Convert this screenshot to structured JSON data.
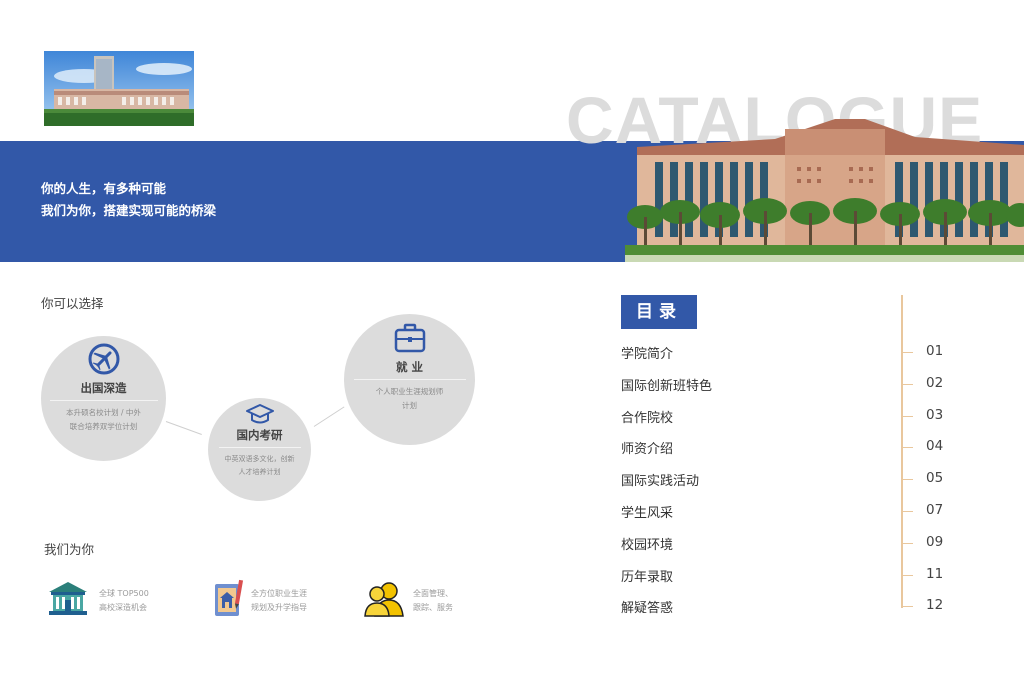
{
  "watermark": "CATALOGUE",
  "banner": {
    "line1": "你的人生，有多种可能",
    "line2": "我们为你，搭建实现可能的桥梁"
  },
  "choices": {
    "title": "你可以选择",
    "items": [
      {
        "icon": "airplane-icon",
        "title": "出国深造",
        "desc1": "本升硕名校计划 / 中外",
        "desc2": "联合培养双学位计划"
      },
      {
        "icon": "graduation-cap-icon",
        "title": "国内考研",
        "desc1": "中英双语多文化，创新",
        "desc2": "人才培养计划"
      },
      {
        "icon": "briefcase-icon",
        "title": "就 业",
        "desc1": "个人职业生涯规划师",
        "desc2": "计划"
      }
    ]
  },
  "services": {
    "title": "我们为你",
    "items": [
      {
        "icon": "university-building-icon",
        "line1": "全球 TOP500",
        "line2": "高校深造机会"
      },
      {
        "icon": "career-plan-icon",
        "line1": "全方位职业生涯",
        "line2": "规划及升学指导"
      },
      {
        "icon": "people-icon",
        "line1": "全面管理、",
        "line2": "跟踪、服务"
      }
    ]
  },
  "toc": {
    "heading": "目录",
    "items": [
      {
        "label": "学院简介",
        "page": "01"
      },
      {
        "label": "国际创新班特色",
        "page": "02"
      },
      {
        "label": "合作院校",
        "page": "03"
      },
      {
        "label": "师资介绍",
        "page": "04"
      },
      {
        "label": "国际实践活动",
        "page": "05"
      },
      {
        "label": "学生风采",
        "page": "07"
      },
      {
        "label": "校园环境",
        "page": "09"
      },
      {
        "label": "历年录取",
        "page": "11"
      },
      {
        "label": "解疑答惑",
        "page": "12"
      }
    ]
  },
  "colors": {
    "brand_blue": "#3258a8",
    "toc_line": "#e9c79d",
    "circle_fill": "#dcdcdc"
  }
}
